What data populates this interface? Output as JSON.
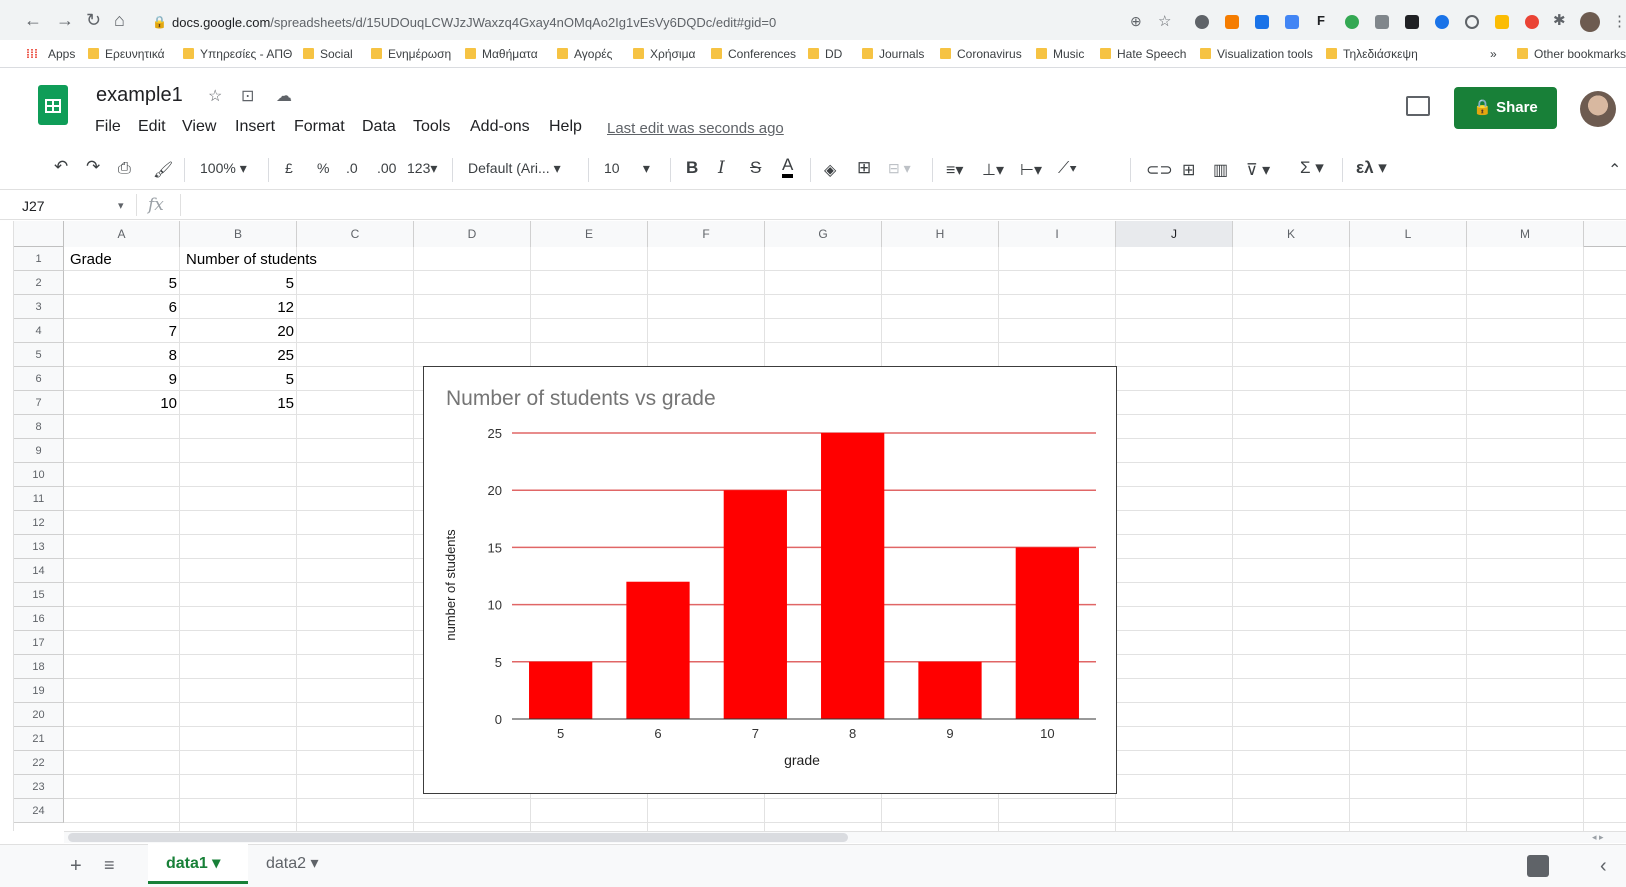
{
  "browser": {
    "url_host": "docs.google.com",
    "url_path": "/spreadsheets/d/15UDOuqLCWJzJWaxzq4Gxay4nOMqAo2Ig1vEsVy6DQDc/edit#gid=0",
    "bookmarks": [
      "Apps",
      "Ερευνητικά",
      "Υπηρεσίες - ΑΠΘ",
      "Social",
      "Ενημέρωση",
      "Μαθήματα",
      "Αγορές",
      "Χρήσιμα",
      "Conferences",
      "DD",
      "Journals",
      "Coronavirus",
      "Music",
      "Hate Speech",
      "Visualization tools",
      "Τηλεδιάσκεψη"
    ],
    "more_bookmarks": "»",
    "other_bookmarks": "Other bookmarks"
  },
  "doc": {
    "title": "example1",
    "menu": [
      "File",
      "Edit",
      "View",
      "Insert",
      "Format",
      "Data",
      "Tools",
      "Add-ons",
      "Help"
    ],
    "last_edit": "Last edit was seconds ago",
    "share_label": "Share"
  },
  "toolbar": {
    "zoom": "100%",
    "currency": "£",
    "percent": "%",
    "dec_less": ".0",
    "dec_more": ".00",
    "format_more": "123",
    "font": "Default (Ari...",
    "font_size": "10",
    "bold": "B",
    "italic": "I",
    "strike": "S",
    "text_color": "A",
    "sigma": "Σ",
    "input_tool": "ελ"
  },
  "formula": {
    "name_box": "J27",
    "fx": "fx"
  },
  "columns": [
    "A",
    "B",
    "C",
    "D",
    "E",
    "F",
    "G",
    "H",
    "I",
    "J",
    "K",
    "L",
    "M"
  ],
  "selected_column": "J",
  "rows": [
    "1",
    "2",
    "3",
    "4",
    "5",
    "6",
    "7",
    "8",
    "9",
    "10",
    "11",
    "12",
    "13",
    "14",
    "15",
    "16",
    "17",
    "18",
    "19",
    "20",
    "21",
    "22",
    "23",
    "24"
  ],
  "cells": {
    "A1": "Grade",
    "B1": "Number of students",
    "A2": "5",
    "B2": "5",
    "A3": "6",
    "B3": "12",
    "A4": "7",
    "B4": "20",
    "A5": "8",
    "B5": "25",
    "A6": "9",
    "B6": "5",
    "A7": "10",
    "B7": "15"
  },
  "sheets": {
    "tabs": [
      "data1",
      "data2"
    ],
    "active": "data1"
  },
  "chart_data": {
    "type": "bar",
    "title": "Number of students vs grade",
    "xlabel": "grade",
    "ylabel": "number of students",
    "categories": [
      "5",
      "6",
      "7",
      "8",
      "9",
      "10"
    ],
    "values": [
      5,
      12,
      20,
      25,
      5,
      15
    ],
    "ylim": [
      0,
      25
    ],
    "yticks": [
      0,
      5,
      10,
      15,
      20,
      25
    ],
    "grid": true,
    "bar_color": "#ff0000",
    "grid_color": "#e06666"
  }
}
